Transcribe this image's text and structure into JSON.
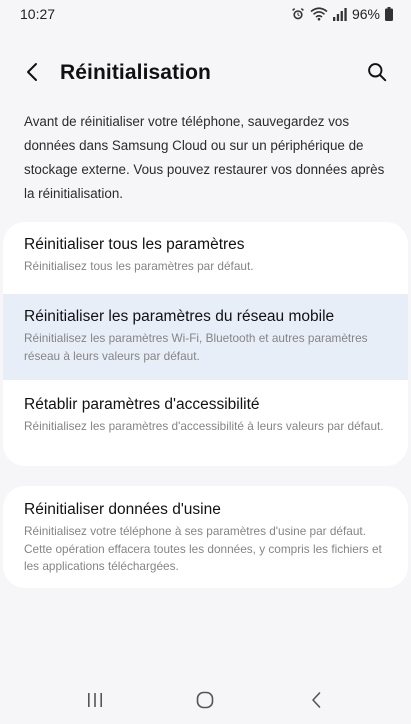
{
  "status_bar": {
    "time": "10:27",
    "battery": "96%",
    "icons": [
      "alarm-icon",
      "wifi-icon",
      "signal-icon",
      "battery-icon"
    ]
  },
  "header": {
    "title": "Réinitialisation",
    "back_icon": "back-arrow-icon",
    "search_icon": "search-icon"
  },
  "intro": {
    "text": "Avant de réinitialiser votre téléphone, sauvegardez vos données dans Samsung Cloud ou sur un périphérique de stockage externe. Vous pouvez restaurer vos données après la réinitialisation."
  },
  "items": [
    {
      "title": "Réinitialiser tous les paramètres",
      "desc": "Réinitialisez tous les paramètres par défaut."
    },
    {
      "title": "Réinitialiser les paramètres du réseau mobile",
      "desc": "Réinitialisez les paramètres Wi-Fi, Bluetooth et autres paramètres réseau à leurs valeurs par défaut."
    },
    {
      "title": "Rétablir paramètres d'accessibilité",
      "desc": "Réinitialisez les paramètres d'accessibilité à leurs valeurs par défaut."
    },
    {
      "title": "Réinitialiser données d'usine",
      "desc": "Réinitialisez votre téléphone à ses paramètres d'usine par défaut. Cette opération effacera toutes les données, y compris les fichiers et les applications téléchargées."
    }
  ],
  "nav_bar": {
    "icons": [
      "recent-apps-icon",
      "home-icon",
      "back-icon"
    ]
  },
  "colors": {
    "background": "#f6f6f8",
    "card": "#ffffff",
    "highlight": "#e8eef8",
    "desc_text": "#858585"
  }
}
